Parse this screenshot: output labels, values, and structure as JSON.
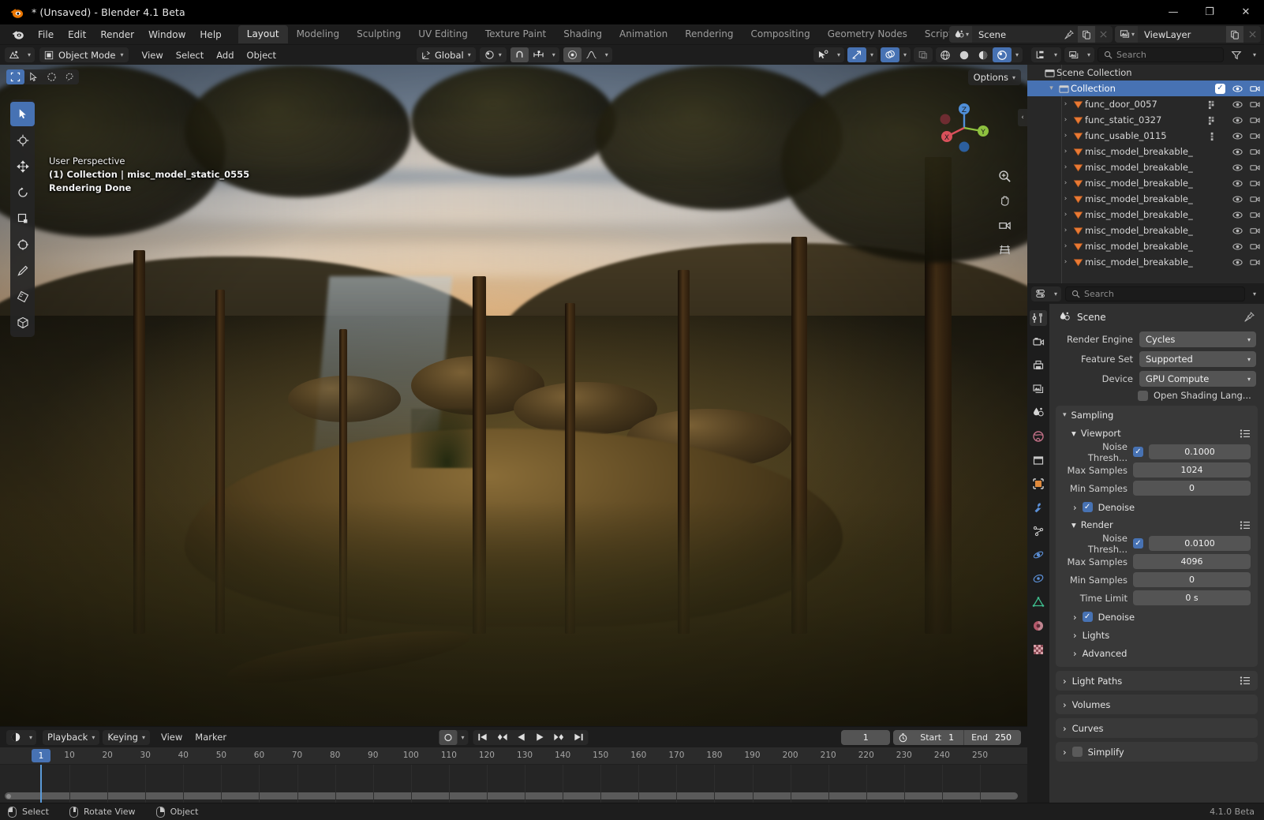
{
  "window": {
    "title": "* (Unsaved) - Blender 4.1 Beta",
    "minimize": "—",
    "maximize": "❐",
    "close": "✕"
  },
  "menubar": {
    "items": [
      "File",
      "Edit",
      "Render",
      "Window",
      "Help"
    ]
  },
  "workspaces": {
    "tabs": [
      "Layout",
      "Modeling",
      "Sculpting",
      "UV Editing",
      "Texture Paint",
      "Shading",
      "Animation",
      "Rendering",
      "Compositing",
      "Geometry Nodes",
      "Scripting"
    ],
    "active": "Layout",
    "add_label": "+"
  },
  "topbar_right": {
    "scene_name": "Scene",
    "viewlayer_name": "ViewLayer",
    "scene_icon": "scene-icon",
    "viewlayer_icon": "viewlayer-icon",
    "pin_icon": "pin-icon",
    "new_icon": "new-datablock-icon",
    "unlink_icon": "unlink-icon"
  },
  "viewport_header": {
    "editor_type_icon": "editor-type-3dview-icon",
    "mode": "Object Mode",
    "menus": [
      "View",
      "Select",
      "Add",
      "Object"
    ],
    "transform_orientation": "Global",
    "pivot_icon": "pivot-point-icon",
    "snap_icon": "snap-magnet-icon",
    "snap_target_icon": "snap-increment-icon",
    "proportional_icon": "proportional-edit-icon",
    "falloff_icon": "proportional-falloff-icon",
    "visibility_icon": "object-visibility-icon",
    "gizmo_icon": "gizmo-icon",
    "overlays_icon": "overlays-icon",
    "xray_icon": "xray-toggle-icon",
    "shading_modes": [
      "wireframe",
      "solid",
      "material-preview",
      "rendered"
    ],
    "active_shading": "rendered"
  },
  "viewport": {
    "select_modes": [
      "tweak",
      "box-select",
      "circle-select",
      "lasso-select"
    ],
    "active_select_mode": "box-select",
    "options_label": "Options",
    "overlay_lines": [
      "User Perspective",
      "(1) Collection | misc_model_static_0555",
      "Rendering Done"
    ],
    "toolbar": [
      {
        "name": "tweak-tool",
        "active": true
      },
      {
        "name": "cursor-tool",
        "active": false
      },
      {
        "name": "move-tool",
        "active": false
      },
      {
        "name": "rotate-tool",
        "active": false
      },
      {
        "name": "scale-tool",
        "active": false
      },
      {
        "name": "transform-tool",
        "active": false
      },
      {
        "name": "annotate-tool",
        "active": false
      },
      {
        "name": "measure-tool",
        "active": false
      },
      {
        "name": "add-cube-tool",
        "active": false
      }
    ],
    "gizmo_axes": [
      "X",
      "Y",
      "Z"
    ],
    "nav_buttons": [
      "zoom-icon",
      "pan-hand-icon",
      "camera-view-icon",
      "orthographic-toggle-icon"
    ]
  },
  "outliner": {
    "display_mode_icon": "outliner-display-mode-icon",
    "filter_id_icon": "filter-id-icon",
    "search_placeholder": "Search",
    "filter_icon": "funnel-filter-icon",
    "rows": [
      {
        "label": "Scene Collection",
        "icon": "collection-icon",
        "indent": 0,
        "selected": false,
        "disclosure": "",
        "checkbox": false,
        "eye": false,
        "camera": false,
        "modifier": ""
      },
      {
        "label": "Collection",
        "icon": "collection-icon",
        "indent": 1,
        "selected": true,
        "disclosure": "down",
        "checkbox": true,
        "eye": true,
        "camera": true,
        "modifier": ""
      },
      {
        "label": "func_door_0057",
        "icon": "mesh-object-icon",
        "indent": 2,
        "selected": false,
        "disclosure": "right",
        "checkbox": false,
        "eye": true,
        "camera": true,
        "modifier": "multi"
      },
      {
        "label": "func_static_0327",
        "icon": "mesh-object-icon",
        "indent": 2,
        "selected": false,
        "disclosure": "right",
        "checkbox": false,
        "eye": true,
        "camera": true,
        "modifier": "multi"
      },
      {
        "label": "func_usable_0115",
        "icon": "mesh-object-icon",
        "indent": 2,
        "selected": false,
        "disclosure": "right",
        "checkbox": false,
        "eye": true,
        "camera": true,
        "modifier": "single"
      },
      {
        "label": "misc_model_breakable_",
        "icon": "mesh-object-icon",
        "indent": 2,
        "selected": false,
        "disclosure": "right",
        "checkbox": false,
        "eye": true,
        "camera": true,
        "modifier": ""
      },
      {
        "label": "misc_model_breakable_",
        "icon": "mesh-object-icon",
        "indent": 2,
        "selected": false,
        "disclosure": "right",
        "checkbox": false,
        "eye": true,
        "camera": true,
        "modifier": ""
      },
      {
        "label": "misc_model_breakable_",
        "icon": "mesh-object-icon",
        "indent": 2,
        "selected": false,
        "disclosure": "right",
        "checkbox": false,
        "eye": true,
        "camera": true,
        "modifier": ""
      },
      {
        "label": "misc_model_breakable_",
        "icon": "mesh-object-icon",
        "indent": 2,
        "selected": false,
        "disclosure": "right",
        "checkbox": false,
        "eye": true,
        "camera": true,
        "modifier": ""
      },
      {
        "label": "misc_model_breakable_",
        "icon": "mesh-object-icon",
        "indent": 2,
        "selected": false,
        "disclosure": "right",
        "checkbox": false,
        "eye": true,
        "camera": true,
        "modifier": ""
      },
      {
        "label": "misc_model_breakable_",
        "icon": "mesh-object-icon",
        "indent": 2,
        "selected": false,
        "disclosure": "right",
        "checkbox": false,
        "eye": true,
        "camera": true,
        "modifier": ""
      },
      {
        "label": "misc_model_breakable_",
        "icon": "mesh-object-icon",
        "indent": 2,
        "selected": false,
        "disclosure": "right",
        "checkbox": false,
        "eye": true,
        "camera": true,
        "modifier": ""
      },
      {
        "label": "misc_model_breakable_",
        "icon": "mesh-object-icon",
        "indent": 2,
        "selected": false,
        "disclosure": "right",
        "checkbox": false,
        "eye": true,
        "camera": true,
        "modifier": ""
      }
    ]
  },
  "properties": {
    "editor_type_icon": "editor-type-properties-icon",
    "search_placeholder": "Search",
    "breadcrumb": "Scene",
    "breadcrumb_icon": "scene-icon",
    "pin_icon": "pin-icon",
    "tabs": [
      {
        "name": "tool",
        "active": true
      },
      {
        "name": "render",
        "active": false
      },
      {
        "name": "output",
        "active": false
      },
      {
        "name": "view-layer",
        "active": false
      },
      {
        "name": "scene",
        "active": false
      },
      {
        "name": "world",
        "active": false
      },
      {
        "name": "collection",
        "active": false
      },
      {
        "name": "object",
        "active": false
      },
      {
        "name": "modifiers",
        "active": false
      },
      {
        "name": "particles",
        "active": false
      },
      {
        "name": "physics",
        "active": false
      },
      {
        "name": "constraints",
        "active": false
      },
      {
        "name": "object-data",
        "active": false
      },
      {
        "name": "material",
        "active": false
      },
      {
        "name": "texture",
        "active": false
      }
    ],
    "render_engine_label": "Render Engine",
    "render_engine_value": "Cycles",
    "feature_set_label": "Feature Set",
    "feature_set_value": "Supported",
    "device_label": "Device",
    "device_value": "GPU Compute",
    "osl_label": "Open Shading Lang...",
    "osl_checked": false,
    "sampling": {
      "title": "Sampling",
      "viewport": {
        "title": "Viewport",
        "noise_threshold_label": "Noise Thresh...",
        "noise_threshold_checked": true,
        "noise_threshold_value": "0.1000",
        "max_samples_label": "Max Samples",
        "max_samples_value": "1024",
        "min_samples_label": "Min Samples",
        "min_samples_value": "0",
        "denoise_label": "Denoise",
        "denoise_checked": true
      },
      "render": {
        "title": "Render",
        "noise_threshold_label": "Noise Thresh...",
        "noise_threshold_checked": true,
        "noise_threshold_value": "0.0100",
        "max_samples_label": "Max Samples",
        "max_samples_value": "4096",
        "min_samples_label": "Min Samples",
        "min_samples_value": "0",
        "time_limit_label": "Time Limit",
        "time_limit_value": "0 s",
        "denoise_label": "Denoise",
        "denoise_checked": true
      },
      "lights_label": "Lights",
      "advanced_label": "Advanced"
    },
    "closed_panels": [
      {
        "label": "Light Paths",
        "has_list_icon": true,
        "has_checkbox": false
      },
      {
        "label": "Volumes",
        "has_list_icon": false,
        "has_checkbox": false
      },
      {
        "label": "Curves",
        "has_list_icon": false,
        "has_checkbox": false
      },
      {
        "label": "Simplify",
        "has_list_icon": false,
        "has_checkbox": true
      }
    ]
  },
  "timeline": {
    "editor_type_icon": "editor-type-timeline-icon",
    "menus": [
      "Playback",
      "Keying",
      "View",
      "Marker"
    ],
    "auto_key_icon": "auto-keying-record-icon",
    "transport": [
      "jump-to-start",
      "jump-to-prev-keyframe",
      "play-reverse",
      "play",
      "jump-to-next-keyframe",
      "jump-to-end"
    ],
    "current_frame": "1",
    "use_preview_range_icon": "preview-range-clock-icon",
    "start_label": "Start",
    "start_value": "1",
    "end_label": "End",
    "end_value": "250",
    "ruler_ticks": [
      "10",
      "20",
      "30",
      "40",
      "50",
      "60",
      "70",
      "80",
      "90",
      "100",
      "110",
      "120",
      "130",
      "140",
      "150",
      "160",
      "170",
      "180",
      "190",
      "200",
      "210",
      "220",
      "230",
      "240",
      "250"
    ],
    "playhead_frame": "1"
  },
  "statusbar": {
    "items": [
      {
        "icon": "mouse-left-icon",
        "label": "Select"
      },
      {
        "icon": "mouse-middle-icon",
        "label": "Rotate View"
      },
      {
        "icon": "mouse-right-icon",
        "label": "Object"
      }
    ],
    "version": "4.1.0 Beta"
  },
  "colors": {
    "accent": "#4772b3",
    "header_bg": "#1d1d1d",
    "panel_bg": "#303030",
    "field_bg": "#545454",
    "outliner_bg": "#282828",
    "mesh_icon": "#ea7a35",
    "axis_x": "#d9515b",
    "axis_y": "#8ec13f",
    "axis_z": "#4f8fd8"
  }
}
